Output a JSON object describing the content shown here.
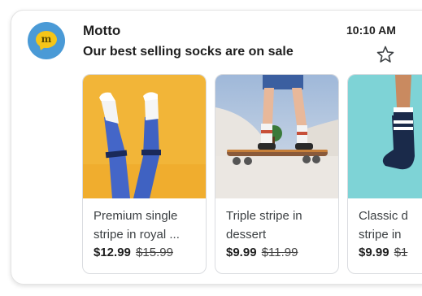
{
  "email": {
    "sender": "Motto",
    "subject": "Our best selling socks are on sale",
    "time": "10:10 AM",
    "avatar_icon": "chat-bubble-m-icon",
    "avatar_letter": "m",
    "colors": {
      "avatar_bg": "#4a9ad6",
      "avatar_bubble": "#f5c518"
    }
  },
  "products": [
    {
      "line1": "Premium single",
      "line2": "stripe in royal ...",
      "price": "$12.99",
      "old_price": "$15.99"
    },
    {
      "line1": "Triple stripe in",
      "line2": "dessert",
      "price": "$9.99",
      "old_price": "$11.99"
    },
    {
      "line1": "Classic d",
      "line2": "stripe in",
      "price": "$9.99",
      "old_price": "$1"
    }
  ]
}
